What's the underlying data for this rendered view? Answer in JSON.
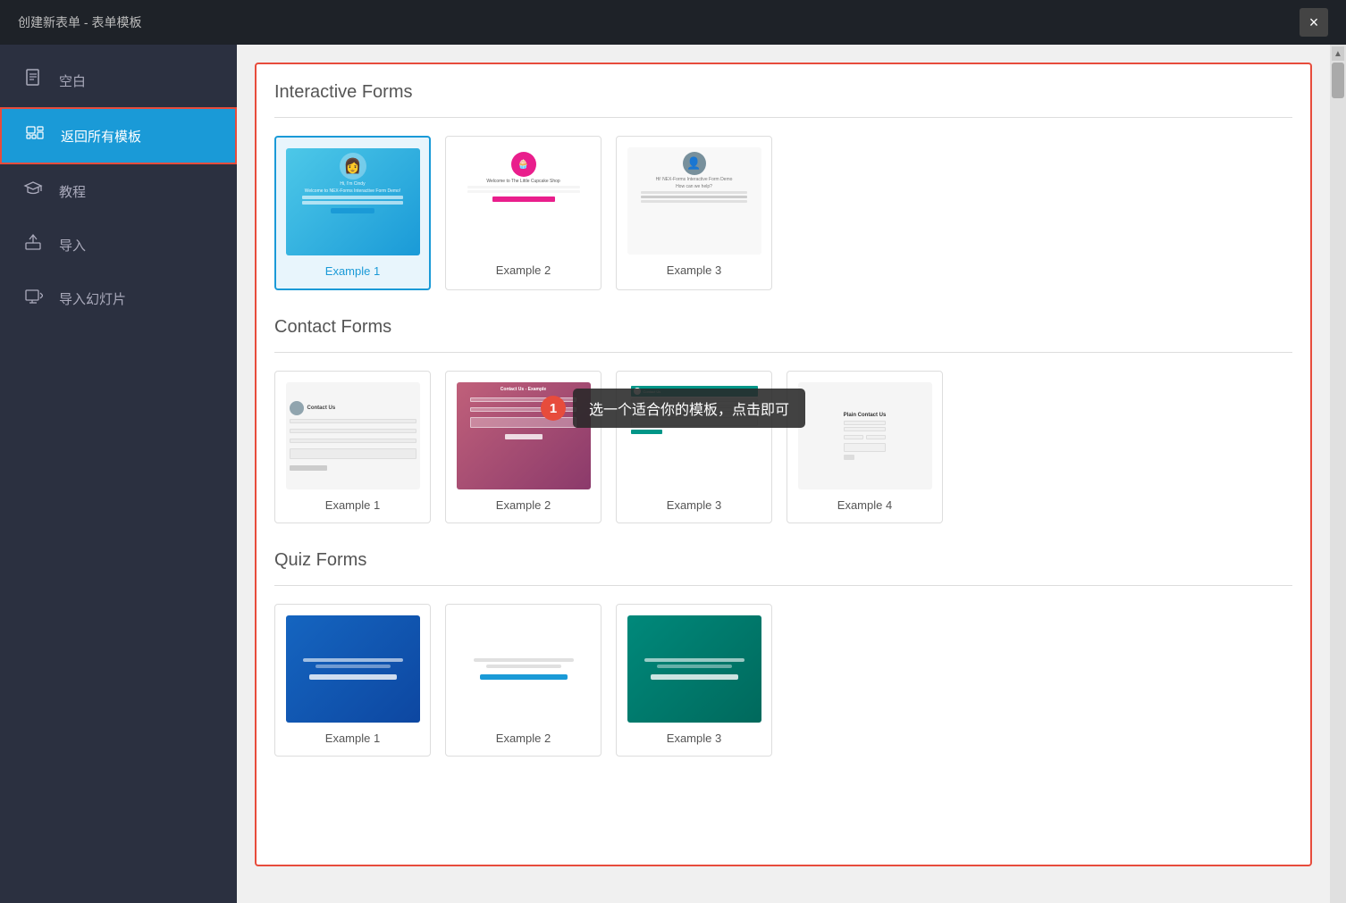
{
  "header": {
    "title": "创建新表单 - 表单模板",
    "close_label": "×"
  },
  "sidebar": {
    "items": [
      {
        "id": "blank",
        "label": "空白",
        "icon": "📄"
      },
      {
        "id": "return",
        "label": "返回所有模板",
        "icon": "📋",
        "active": true
      },
      {
        "id": "tutorial",
        "label": "教程",
        "icon": "🎓"
      },
      {
        "id": "import",
        "label": "导入",
        "icon": "📤"
      },
      {
        "id": "import-slides",
        "label": "导入幻灯片",
        "icon": "📥"
      }
    ]
  },
  "tooltip": {
    "badge": "1",
    "text": "选一个适合你的模板，点击即可"
  },
  "sections": {
    "interactive_forms": {
      "title": "Interactive Forms",
      "examples": [
        {
          "label": "Example 1",
          "selected": true
        },
        {
          "label": "Example 2",
          "selected": false
        },
        {
          "label": "Example 3",
          "selected": false
        }
      ]
    },
    "contact_forms": {
      "title": "Contact Forms",
      "examples": [
        {
          "label": "Example 1"
        },
        {
          "label": "Example 2"
        },
        {
          "label": "Example 3"
        },
        {
          "label": "Example 4"
        }
      ]
    },
    "quiz_forms": {
      "title": "Quiz Forms",
      "examples": [
        {
          "label": "Example 1"
        },
        {
          "label": "Example 2"
        },
        {
          "label": "Example 3"
        }
      ]
    }
  }
}
